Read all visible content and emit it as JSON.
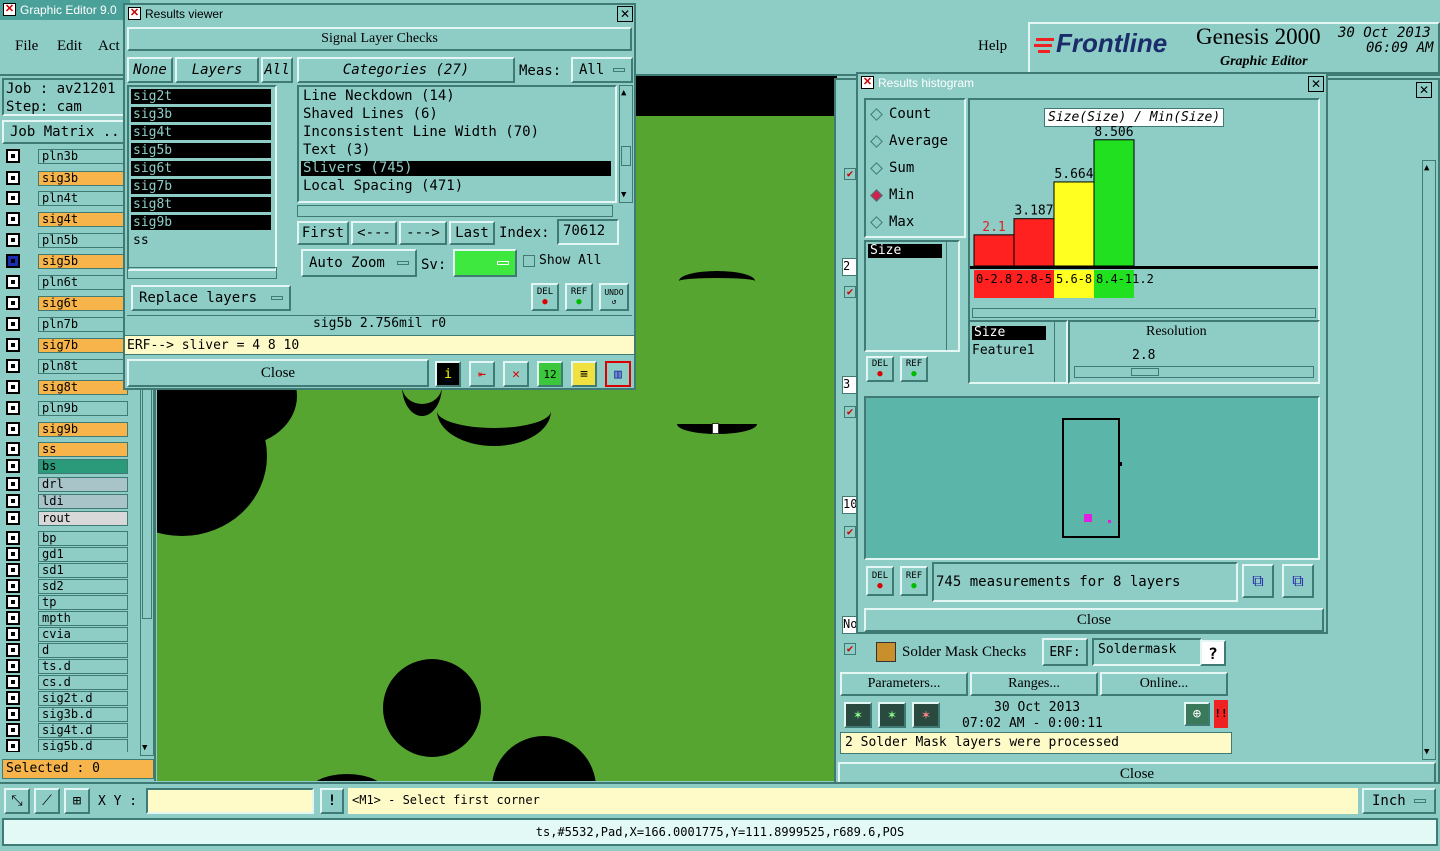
{
  "app": {
    "title": "Graphic Editor 9.0",
    "menu": [
      "File",
      "Edit",
      "Act"
    ],
    "help": "Help",
    "brand": "Frontline",
    "product": "Genesis 2000",
    "subtitle": "Graphic Editor",
    "date": "30 Oct 2013",
    "time": "06:09 AM"
  },
  "left": {
    "job": "Job : av21201",
    "step": "Step: cam",
    "job_matrix": "Job Matrix ...",
    "selected": "Selected : 0",
    "layers": [
      {
        "name": "pln3b",
        "color": "#8ecdc6",
        "mark": ""
      },
      {
        "name": "sig3b",
        "color": "#f7b44a",
        "mark": "✎"
      },
      {
        "name": "pln4t",
        "color": "#8ecdc6",
        "mark": ""
      },
      {
        "name": "sig4t",
        "color": "#f7b44a",
        "mark": "✎"
      },
      {
        "name": "pln5b",
        "color": "#8ecdc6",
        "mark": ""
      },
      {
        "name": "sig5b",
        "color": "#f7b44a",
        "mark": "✎"
      },
      {
        "name": "pln6t",
        "color": "#8ecdc6",
        "mark": ""
      },
      {
        "name": "sig6t",
        "color": "#f7b44a",
        "mark": "✎"
      },
      {
        "name": "pln7b",
        "color": "#8ecdc6",
        "mark": ""
      },
      {
        "name": "sig7b",
        "color": "#f7b44a",
        "mark": "✎"
      },
      {
        "name": "pln8t",
        "color": "#8ecdc6",
        "mark": ""
      },
      {
        "name": "sig8t",
        "color": "#f7b44a",
        "mark": "✎"
      },
      {
        "name": "pln9b",
        "color": "#8ecdc6",
        "mark": ""
      },
      {
        "name": "sig9b",
        "color": "#f7b44a",
        "mark": "✎"
      },
      {
        "name": "ss",
        "color": "#f7b44a",
        "mark": "✎"
      },
      {
        "name": "bs",
        "color": "#2a9a7a",
        "mark": "✎"
      },
      {
        "name": "drl",
        "color": "#a8c4c8",
        "mark": ""
      },
      {
        "name": "ldi",
        "color": "#a8c4c8",
        "mark": ""
      },
      {
        "name": "rout",
        "color": "#d8d8d8",
        "mark": ""
      },
      {
        "name": "bp",
        "color": "#8ecdc6",
        "mark": ""
      },
      {
        "name": "gd1",
        "color": "#8ecdc6",
        "mark": "✎"
      },
      {
        "name": "sd1",
        "color": "#8ecdc6",
        "mark": ""
      },
      {
        "name": "sd2",
        "color": "#8ecdc6",
        "mark": ""
      },
      {
        "name": "tp",
        "color": "#8ecdc6",
        "mark": ""
      },
      {
        "name": "mpth",
        "color": "#8ecdc6",
        "mark": ""
      },
      {
        "name": "cvia",
        "color": "#8ecdc6",
        "mark": ""
      },
      {
        "name": "d",
        "color": "#8ecdc6",
        "mark": ""
      },
      {
        "name": "ts.d",
        "color": "#8ecdc6",
        "mark": "✎"
      },
      {
        "name": "cs.d",
        "color": "#8ecdc6",
        "mark": "✎"
      },
      {
        "name": "sig2t.d",
        "color": "#8ecdc6",
        "mark": "✎"
      },
      {
        "name": "sig3b.d",
        "color": "#8ecdc6",
        "mark": "✎"
      },
      {
        "name": "sig4t.d",
        "color": "#8ecdc6",
        "mark": "✎"
      },
      {
        "name": "sig5b.d",
        "color": "#8ecdc6",
        "mark": "✎"
      }
    ]
  },
  "viewer": {
    "title": "Results viewer",
    "heading": "Signal Layer Checks",
    "none": "None",
    "layers_label": "Layers",
    "all": "All",
    "categories_label": "Categories (27)",
    "meas_label": "Meas:",
    "meas_value": "All",
    "layer_list": [
      "sig2t",
      "sig3b",
      "sig4t",
      "sig5b",
      "sig6t",
      "sig7b",
      "sig8t",
      "sig9b",
      "ss"
    ],
    "category_list": [
      "Line Neckdown (14)",
      "Shaved Lines (6)",
      "Inconsistent Line Width (70)",
      "Text (3)",
      "Slivers (745)",
      "Local Spacing (471)"
    ],
    "selected_category": 4,
    "first": "First",
    "prev": "<---",
    "next": "--->",
    "last": "Last",
    "index_label": "Index:",
    "index_value": "70612",
    "auto_zoom": "Auto Zoom",
    "sv_label": "Sv:",
    "show_all": "Show All",
    "replace_layers": "Replace layers",
    "del": "DEL",
    "ref": "REF",
    "undo": "UNDO",
    "status": "sig5b 2.756mil  r0",
    "erf": "ERF--> sliver = 4 8 10",
    "close": "Close"
  },
  "histogram": {
    "title": "Results histogram",
    "modes": [
      "Count",
      "Average",
      "Sum",
      "Min",
      "Max"
    ],
    "selected_mode": "Min",
    "size_label": "Size",
    "chart_title": "Size(Size) / Min(Size)",
    "resolution_label": "Resolution",
    "resolution_value": "2.8",
    "list": [
      "Size",
      "Feature1"
    ],
    "measurements": "745 measurements for 8 layers",
    "close": "Close",
    "del": "DEL",
    "ref": "REF"
  },
  "chart_data": {
    "type": "bar",
    "title": "Size(Size) / Min(Size)",
    "categories": [
      "0-2.8",
      "2.8-5.6",
      "5.6-8.4",
      "8.4-11.2"
    ],
    "values": [
      2.1,
      3.187,
      5.664,
      8.506
    ],
    "value_labels": [
      "2.1",
      "3.187",
      "5.664",
      "8.506"
    ],
    "colors": [
      "#ff2020",
      "#ff2020",
      "#ffff20",
      "#20e020"
    ],
    "ylim": [
      0,
      9
    ]
  },
  "right": {
    "row_labels": [
      "2",
      "3",
      "10",
      "No"
    ],
    "solder_mask": "Solder Mask Checks",
    "erf_label": "ERF:",
    "erf_value": "Soldermask",
    "help": "?",
    "parameters": "Parameters...",
    "ranges": "Ranges...",
    "online": "Online...",
    "date": "30 Oct 2013",
    "time": "07:02 AM - 0:00:11",
    "alert": "!!",
    "message": "2 Solder Mask layers were processed",
    "close": "Close"
  },
  "bottom": {
    "xy_label": "X Y :",
    "xy_value": "",
    "bang": "!",
    "prompt": "<M1> - Select first corner",
    "units": "Inch",
    "status": "ts,#5532,Pad,X=166.0001775,Y=111.8999525,r689.6,POS"
  }
}
